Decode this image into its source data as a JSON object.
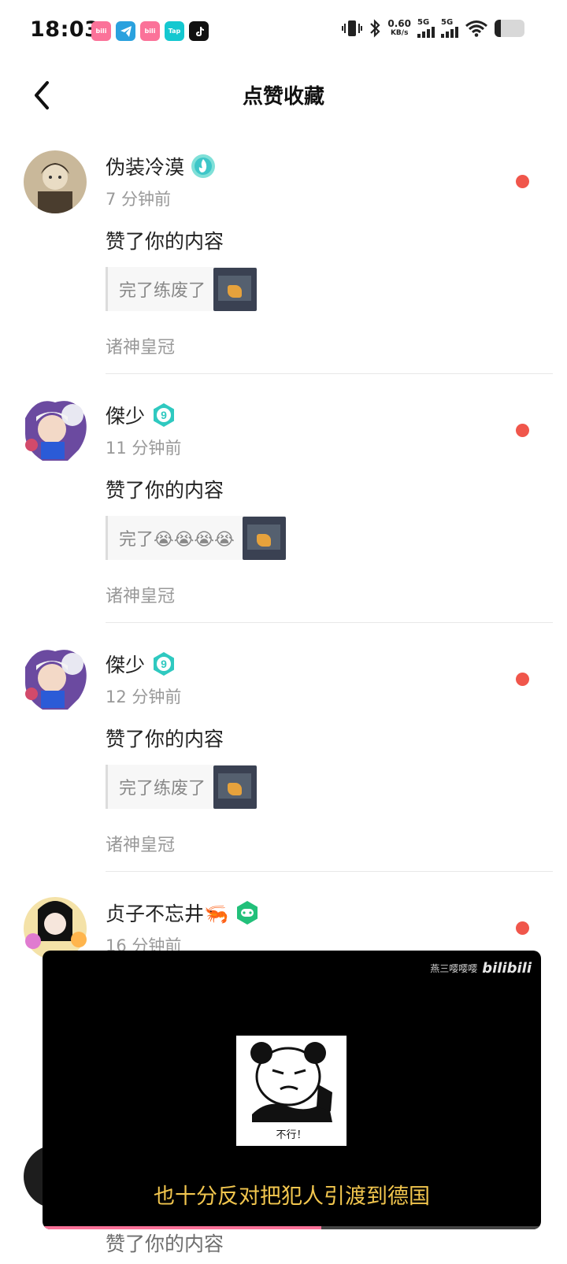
{
  "status_bar": {
    "time": "18:03",
    "net_speed_value": "0.60",
    "net_speed_unit": "KB/s",
    "sim1": "5G",
    "sim2": "5G",
    "app_icons": [
      "bilibili-icon",
      "telegram-icon",
      "bilibili-icon",
      "taptap-icon",
      "tiktok-icon"
    ],
    "app_icon_labels": [
      "bili",
      "",
      "bili",
      "Tap",
      ""
    ],
    "icons": [
      "vibrate-icon",
      "bluetooth-icon",
      "wifi-icon",
      "battery-icon"
    ]
  },
  "header": {
    "title": "点赞收藏",
    "back_icon": "chevron-left-icon"
  },
  "notifications": [
    {
      "user": "伪装冷漠",
      "badge": "level-flame-badge",
      "time": "7 分钟前",
      "action": "赞了你的内容",
      "quote": "完了练废了",
      "source": "诸神皇冠",
      "unread": true
    },
    {
      "user": "傑少",
      "badge": "level-9-badge",
      "badge_text": "9",
      "time": "11 分钟前",
      "action": "赞了你的内容",
      "quote": "完了😭😭😭😭",
      "source": "诸神皇冠",
      "unread": true
    },
    {
      "user": "傑少",
      "badge": "level-9-badge",
      "badge_text": "9",
      "time": "12 分钟前",
      "action": "赞了你的内容",
      "quote": "完了练废了",
      "source": "诸神皇冠",
      "unread": true
    },
    {
      "user": "贞子不忘井🦐",
      "badge": "gamepad-badge",
      "time": "16 分钟前",
      "unread": true
    }
  ],
  "video_popup": {
    "watermark_user": "燕三嘤嘤嘤",
    "watermark_logo": "bilibili",
    "meme_caption": "不行！",
    "subtitle": "也十分反对把犯人引渡到德国",
    "progress": 0.56
  },
  "peek": {
    "action_partial": "赞了你的内容"
  },
  "colors": {
    "unread_dot": "#f0564b",
    "badge_teal": "#2fc9c0",
    "subtitle_yellow": "#f2c64e",
    "progress_pink": "#fb7299"
  }
}
